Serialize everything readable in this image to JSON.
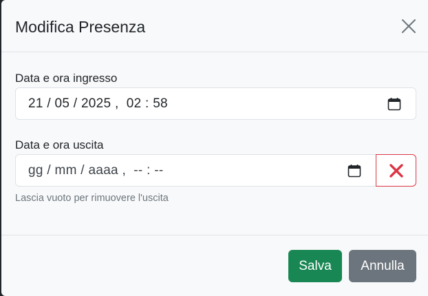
{
  "modal": {
    "title": "Modifica Presenza"
  },
  "entry": {
    "label": "Data e ora ingresso",
    "value": "21 / 05 / 2025 ,  02 : 58"
  },
  "exit": {
    "label": "Data e ora uscita",
    "placeholder": "gg / mm / aaaa ,  -- : --",
    "help": "Lascia vuoto per rimuovere l'uscita"
  },
  "footer": {
    "save_label": "Salva",
    "cancel_label": "Annulla"
  },
  "icons": {
    "close": "close-icon",
    "calendar": "calendar-icon",
    "clear": "x-icon"
  },
  "colors": {
    "save": "#198754",
    "cancel": "#6c757d",
    "danger": "#dc3545"
  }
}
